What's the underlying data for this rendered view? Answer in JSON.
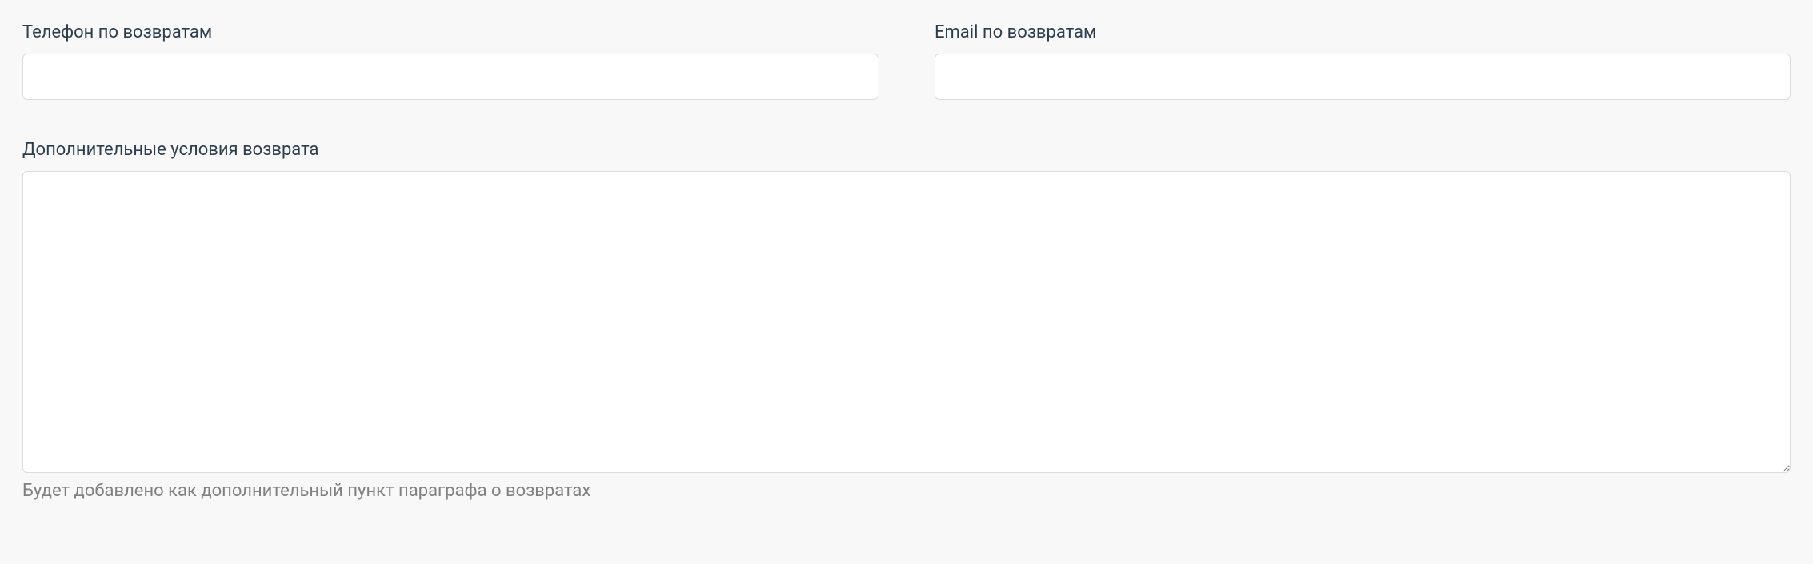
{
  "returns": {
    "phone": {
      "label": "Телефон по возвратам",
      "value": ""
    },
    "email": {
      "label": "Email по возвратам",
      "value": ""
    },
    "conditions": {
      "label": "Дополнительные условия возврата",
      "value": "",
      "help_text": "Будет добавлено как дополнительный пункт параграфа о возвратах"
    }
  }
}
